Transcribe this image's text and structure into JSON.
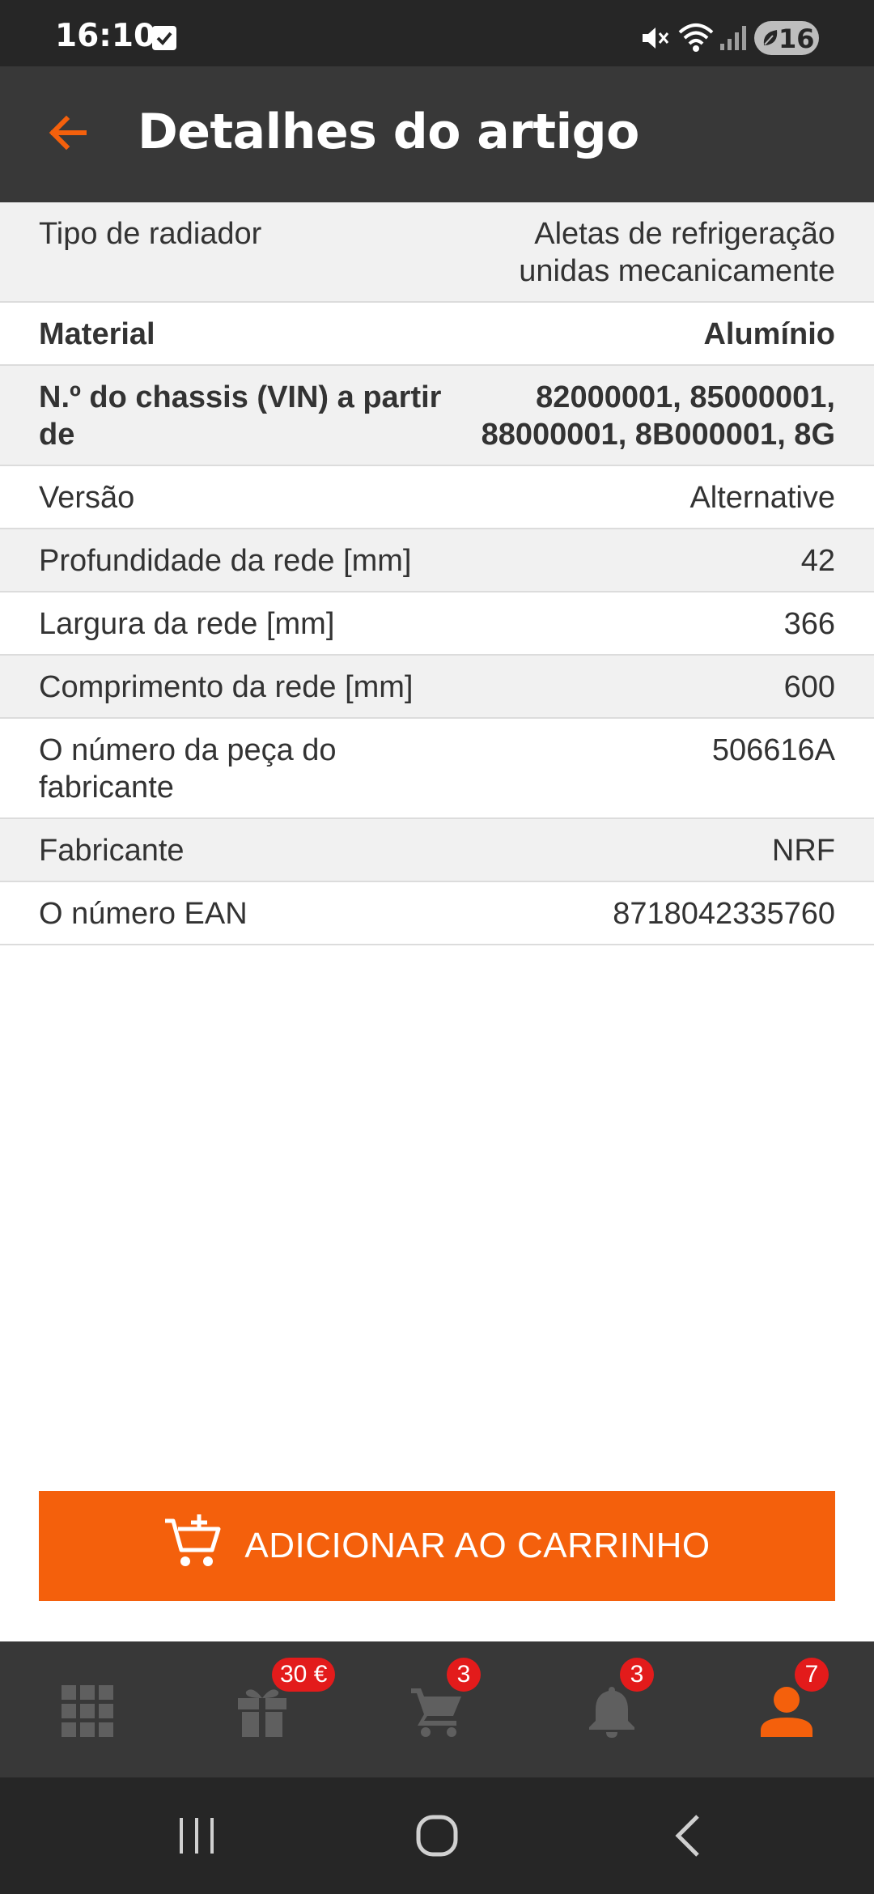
{
  "status_bar": {
    "time": "16:10",
    "battery": "16",
    "icons": [
      "checkbox-notification-icon",
      "mute-icon",
      "wifi-icon",
      "signal-icon",
      "battery-saver-icon"
    ]
  },
  "app_bar": {
    "title": "Detalhes do artigo",
    "back_icon": "arrow-left-icon",
    "accent_color": "#F4600C"
  },
  "details": [
    {
      "label": "Tipo de radiador",
      "value": "Aletas de refrigeração unidas mecanicamente"
    },
    {
      "label": "Material",
      "value": "Alumínio"
    },
    {
      "label": "N.º do chassis (VIN) a partir de",
      "value": "82000001, 85000001, 88000001, 8B000001, 8G"
    },
    {
      "label": "Versão",
      "value": "Alternative"
    },
    {
      "label": "Profundidade da rede [mm]",
      "value": "42"
    },
    {
      "label": "Largura da rede [mm]",
      "value": "366"
    },
    {
      "label": "Comprimento da rede [mm]",
      "value": "600"
    },
    {
      "label": "O número da peça do fabricante",
      "value": "506616A"
    },
    {
      "label": "Fabricante",
      "value": "NRF"
    },
    {
      "label": "O número EAN",
      "value": "8718042335760"
    }
  ],
  "add_to_cart": {
    "label": "ADICIONAR AO CARRINHO",
    "color": "#F4600C"
  },
  "bottom_nav": {
    "items": [
      {
        "icon": "grid-icon",
        "badge": ""
      },
      {
        "icon": "gift-icon",
        "badge": "30 €"
      },
      {
        "icon": "cart-icon",
        "badge": "3"
      },
      {
        "icon": "bell-icon",
        "badge": "3"
      },
      {
        "icon": "user-icon",
        "badge": "7"
      }
    ],
    "badge_color": "#E31B1B"
  }
}
